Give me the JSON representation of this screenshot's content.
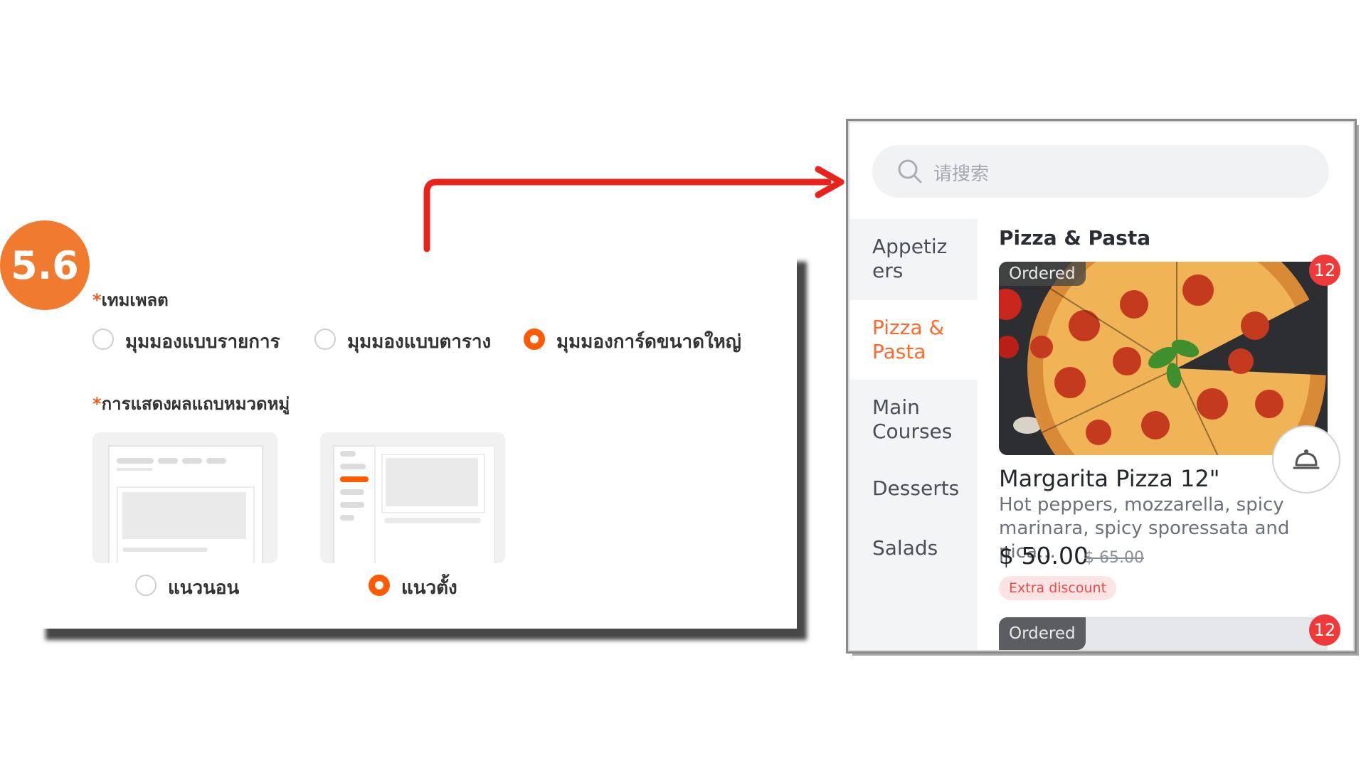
{
  "step": {
    "number": "5.6"
  },
  "settings": {
    "template_section": {
      "required_mark": "*",
      "title": "เทมเพลต",
      "options": [
        {
          "label": "มุมมองแบบรายการ",
          "selected": false
        },
        {
          "label": "มุมมองแบบตาราง",
          "selected": false
        },
        {
          "label": "มุมมองการ์ดขนาดใหญ่",
          "selected": true
        }
      ]
    },
    "category_bar_section": {
      "required_mark": "*",
      "title": "การแสดงผลแถบหมวดหมู่",
      "options": [
        {
          "label": "แนวนอน",
          "selected": false
        },
        {
          "label": "แนวตั้ง",
          "selected": true
        }
      ]
    }
  },
  "preview": {
    "search": {
      "placeholder": "请搜索",
      "icon": "search-icon"
    },
    "categories": [
      {
        "label": "Appetiz\ners",
        "active": false
      },
      {
        "label": "Pizza &\nPasta",
        "active": true
      },
      {
        "label": "Main\nCourses",
        "active": false
      },
      {
        "label": "Desserts",
        "active": false
      },
      {
        "label": "Salads",
        "active": false
      }
    ],
    "category_title": "Pizza & Pasta",
    "item": {
      "ordered_tag": "Ordered",
      "count": "12",
      "name": "Margarita Pizza 12\"",
      "description": "Hot peppers, mozzarella, spicy marinara, spicy sporessata and pica…",
      "price": "$ 50.00",
      "original_price": "$ 65.00",
      "discount_label": "Extra discount",
      "icon": "service-bell-icon"
    },
    "next_item": {
      "ordered_tag": "Ordered",
      "count": "12"
    }
  },
  "colors": {
    "accent": "#ff5a00",
    "step_badge": "#f07a2e",
    "arrow": "#e8231c",
    "badge": "#f03a3a"
  }
}
